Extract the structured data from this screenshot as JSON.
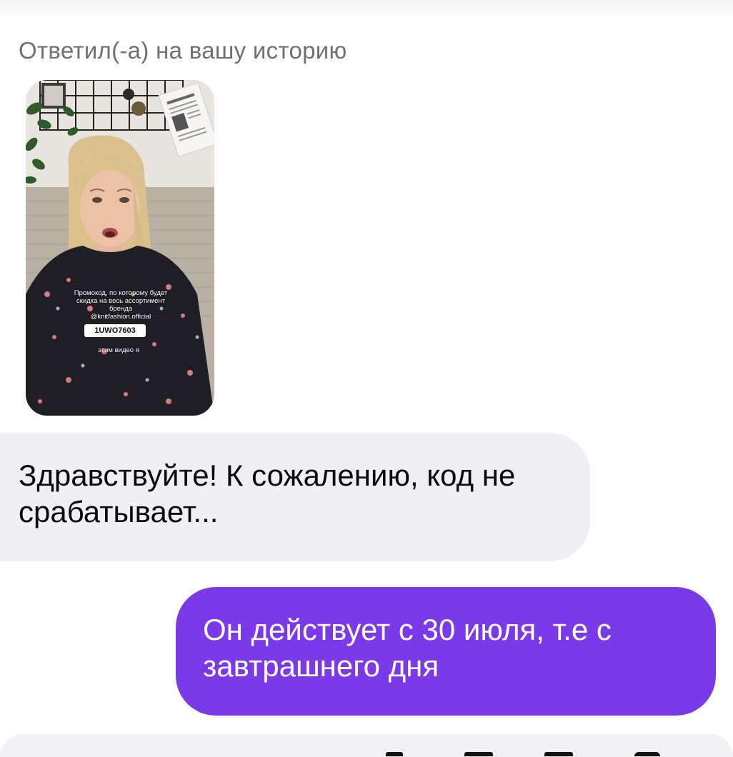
{
  "reply_caption": "Ответил(-а) на вашу историю",
  "story": {
    "overlay_lines": [
      "Промокод, по которому будет",
      "скидка на весь ассортимент",
      "бренда",
      "@knitfashion.official"
    ],
    "promo_code": "1UWO7603",
    "tail_text": "этим видео я"
  },
  "messages": [
    {
      "direction": "incoming",
      "text": "Здравствуйте! К сожалению, код не срабатывает..."
    },
    {
      "direction": "outgoing",
      "text": "Он действует с 30 июля, т.е с завтрашнего дня"
    }
  ],
  "colors": {
    "incoming_bubble": "#efeff4",
    "outgoing_bubble": "#7b3aea",
    "caption": "#707075"
  }
}
